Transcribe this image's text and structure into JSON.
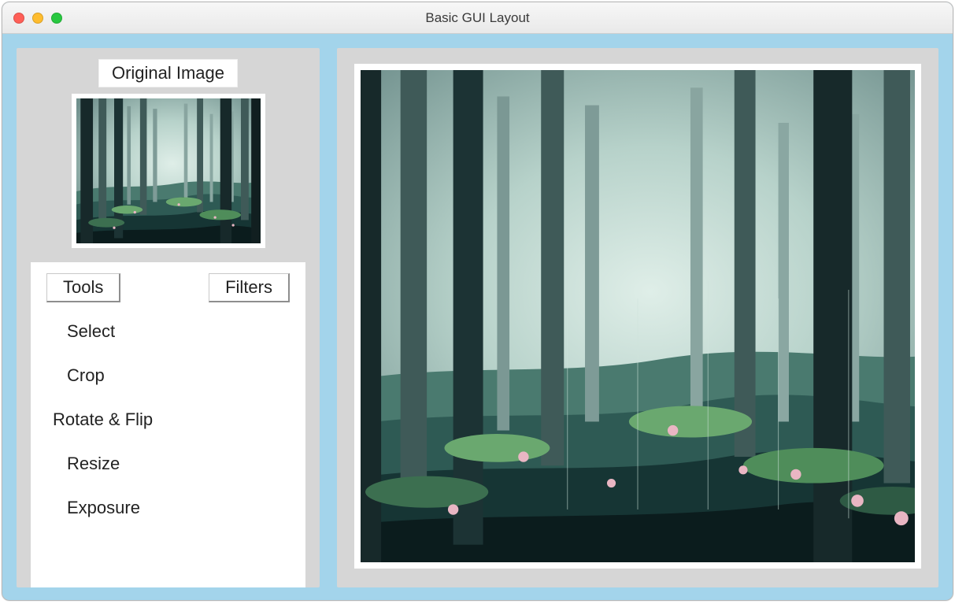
{
  "window": {
    "title": "Basic GUI Layout"
  },
  "sidebar": {
    "original_label": "Original Image",
    "tabs": {
      "tools": "Tools",
      "filters": "Filters"
    },
    "tools": [
      "Select",
      "Crop",
      "Rotate & Flip",
      "Resize",
      "Exposure"
    ]
  },
  "image": {
    "description": "forest-illustration"
  }
}
